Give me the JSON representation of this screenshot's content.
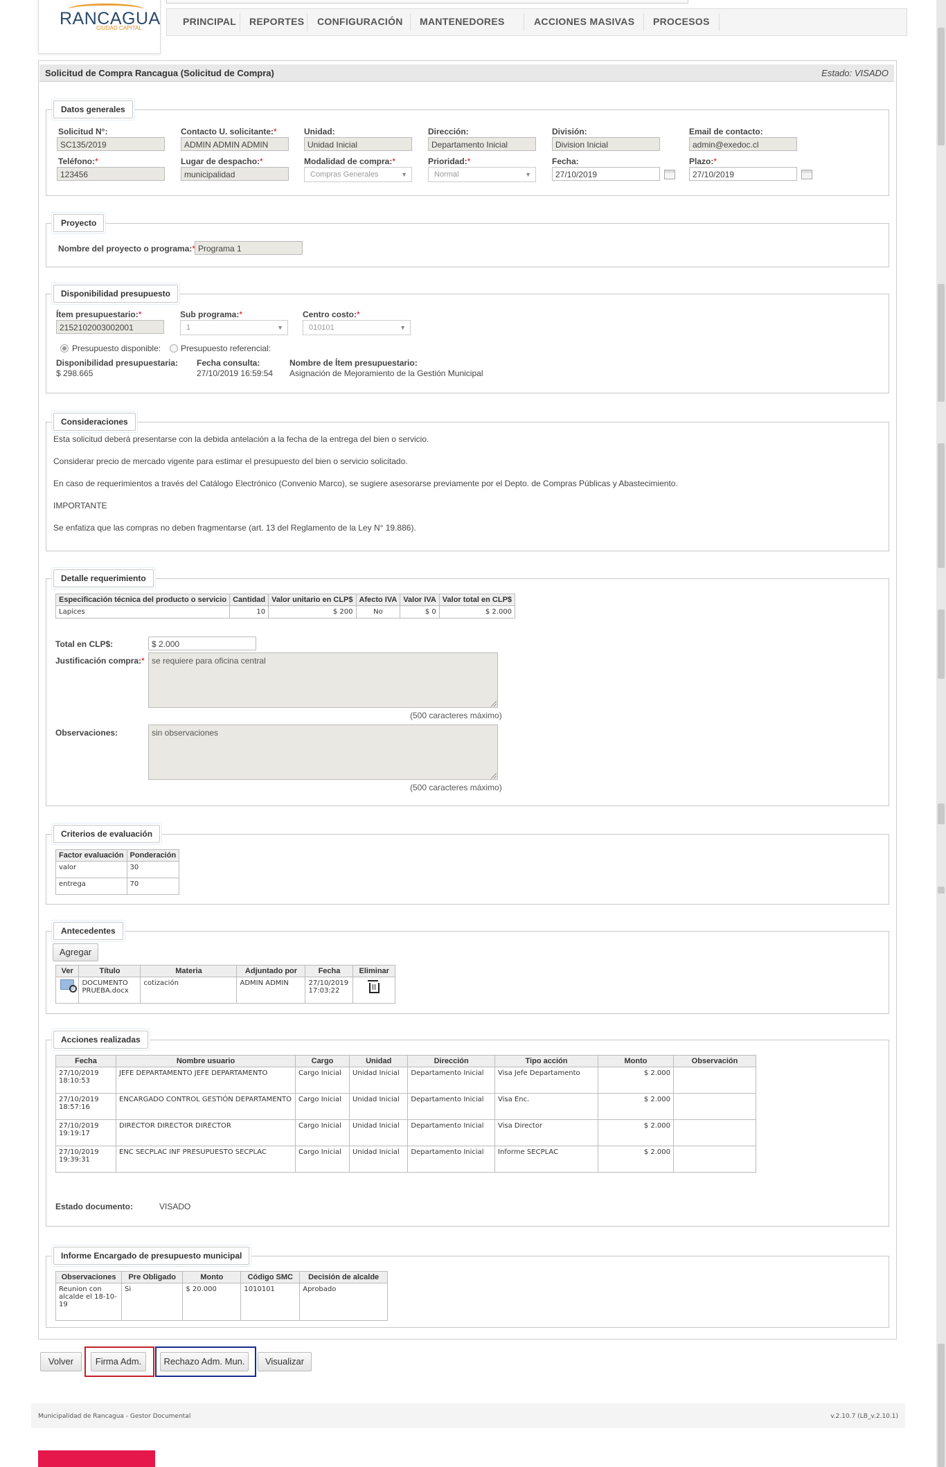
{
  "header": {
    "logo_text": "RANCAGUA",
    "logo_sub": "CIUDAD CAPITAL",
    "nav": [
      "PRINCIPAL",
      "REPORTES",
      "CONFIGURACIÓN",
      "MANTENEDORES",
      "ACCIONES MASIVAS",
      "PROCESOS"
    ]
  },
  "title": {
    "text": "Solicitud de Compra Rancagua (Solicitud de Compra)",
    "status": "Estado: VISADO"
  },
  "datos_generales": {
    "legend": "Datos generales",
    "solicitud_label": "Solicitud N°:",
    "solicitud_value": "SC135/2019",
    "contacto_label": "Contacto U. solicitante:",
    "contacto_value": "ADMIN ADMIN ADMIN",
    "unidad_label": "Unidad:",
    "unidad_value": "Unidad Inicial",
    "direccion_label": "Dirección:",
    "direccion_value": "Departamento Inicial",
    "division_label": "División:",
    "division_value": "Division Inicial",
    "email_label": "Email de contacto:",
    "email_value": "admin@exedoc.cl",
    "telefono_label": "Teléfono:",
    "telefono_value": "123456",
    "lugar_label": "Lugar de despacho:",
    "lugar_value": "municipalidad",
    "modalidad_label": "Modalidad de compra:",
    "modalidad_value": "Compras Generales",
    "prioridad_label": "Prioridad:",
    "prioridad_value": "Normal",
    "fecha_label": "Fecha:",
    "fecha_value": "27/10/2019",
    "plazo_label": "Plazo:",
    "plazo_value": "27/10/2019"
  },
  "proyecto": {
    "legend": "Proyecto",
    "label": "Nombre del proyecto o programa:",
    "value": "Programa 1"
  },
  "presupuesto": {
    "legend": "Disponibilidad presupuesto",
    "item_label": "Ítem presupuestario:",
    "item_value": "215210200300​2001",
    "subprograma_label": "Sub programa:",
    "subprograma_value": "1",
    "centro_label": "Centro costo:",
    "centro_value": "010101",
    "radio_disponible": "Presupuesto disponible:",
    "radio_referencial": "Presupuesto referencial:",
    "disp_label": "Disponibilidad presupuestaria:",
    "disp_value": "$ 298.665",
    "fecha_consulta_label": "Fecha consulta:",
    "fecha_consulta_value": "27/10/2019 16:59:54",
    "nombre_item_label": "Nombre de Ítem presupuestario:",
    "nombre_item_value": "Asignación de Mejoramiento de la Gestión Municipal"
  },
  "consideraciones": {
    "legend": "Consideraciones",
    "lines": [
      "Esta solicitud deberá presentarse con la debida antelación a la fecha de la entrega del bien o servicio.",
      "Considerar precio de mercado vigente para estimar el presupuesto del bien o servicio solicitado.",
      "En caso de requerimientos a través del Catálogo Electrónico (Convenio Marco), se sugiere asesorarse previamente por el Depto. de Compras Públicas y Abastecimiento.",
      "IMPORTANTE",
      "Se enfatiza que las compras no deben fragmentarse (art. 13 del Reglamento de la Ley N° 19.886)."
    ]
  },
  "detalle": {
    "legend": "Detalle requerimiento",
    "headers": [
      "Especificación técnica del producto o servicio",
      "Cantidad",
      "Valor unitario en CLP$",
      "Afecto IVA",
      "Valor IVA",
      "Valor total en CLP$"
    ],
    "rows": [
      [
        "Lapices",
        "10",
        "$ 200",
        "No",
        "$ 0",
        "$ 2.000"
      ]
    ],
    "total_label": "Total en CLP$:",
    "total_value": "$ 2.000",
    "justificacion_label": "Justificación compra:",
    "justificacion_value": "se requiere para oficina central",
    "observaciones_label": "Observaciones:",
    "observaciones_value": "sin observaciones",
    "max_hint": "(500 caracteres máximo)"
  },
  "criterios": {
    "legend": "Criterios de evaluación",
    "headers": [
      "Factor evaluación",
      "Ponderación"
    ],
    "rows": [
      [
        "valor",
        "30"
      ],
      [
        "entrega",
        "70"
      ]
    ]
  },
  "antecedentes": {
    "legend": "Antecedentes",
    "add_button": "Agregar",
    "headers": [
      "Ver",
      "Título",
      "Materia",
      "Adjuntado por",
      "Fecha",
      "Eliminar"
    ],
    "rows": [
      [
        "",
        "DOCUMENTO PRUEBA.docx",
        "cotización",
        "ADMIN ADMIN",
        "27/10/2019 17:03:22",
        ""
      ]
    ]
  },
  "acciones": {
    "legend": "Acciones realizadas",
    "headers": [
      "Fecha",
      "Nombre usuario",
      "Cargo",
      "Unidad",
      "Dirección",
      "Tipo acción",
      "Monto",
      "Observación"
    ],
    "rows": [
      [
        "27/10/2019 18:10:53",
        "JEFE DEPARTAMENTO JEFE DEPARTAMENTO",
        "Cargo Inicial",
        "Unidad Inicial",
        "Departamento Inicial",
        "Visa Jefe Departamento",
        "$ 2.000",
        ""
      ],
      [
        "27/10/2019 18:57:16",
        "ENCARGADO CONTROL GESTIÓN DEPARTAMENTO",
        "Cargo Inicial",
        "Unidad Inicial",
        "Departamento Inicial",
        "Visa Enc.",
        "$ 2.000",
        ""
      ],
      [
        "27/10/2019 19:19:17",
        "DIRECTOR DIRECTOR DIRECTOR",
        "Cargo Inicial",
        "Unidad Inicial",
        "Departamento Inicial",
        "Visa Director",
        "$ 2.000",
        ""
      ],
      [
        "27/10/2019 19:39:31",
        "ENC SECPLAC INF PRESUPUESTO SECPLAC",
        "Cargo Inicial",
        "Unidad Inicial",
        "Departamento Inicial",
        "Informe SECPLAC",
        "$ 2.000",
        ""
      ]
    ],
    "estado_label": "Estado documento:",
    "estado_value": "VISADO"
  },
  "informe": {
    "legend": "Informe Encargado de presupuesto municipal",
    "headers": [
      "Observaciones",
      "Pre Obligado",
      "Monto",
      "Código SMC",
      "Decisión de alcalde"
    ],
    "rows": [
      [
        "Reunion con alcalde el 18-10-19",
        "Si",
        "$ 20.000",
        "1010101",
        "Aprobado"
      ]
    ]
  },
  "buttons": {
    "volver": "Volver",
    "firma": "Firma Adm.",
    "rechazo": "Rechazo Adm. Mun.",
    "visualizar": "Visualizar"
  },
  "footer": {
    "left": "Municipalidad de Rancagua - Gestor Documental",
    "right": "v.2.10.7 (LB_v.2.10.1)"
  },
  "colors": {
    "highlight_red": "#c0202a",
    "highlight_blue": "#1a2a8c",
    "brand_pink": "#e5174b"
  }
}
